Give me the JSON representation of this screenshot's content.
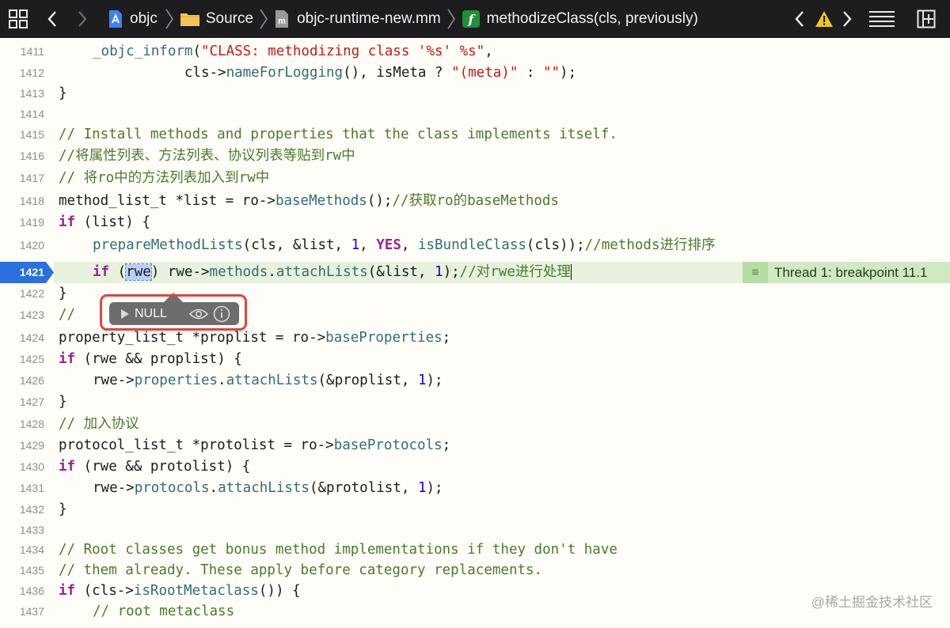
{
  "breadcrumb": {
    "project": "objc",
    "folder": "Source",
    "file": "objc-runtime-new.mm",
    "symbol": "methodizeClass(cls, previously)"
  },
  "toolbar": {
    "grid_icon": "grid-icon",
    "back_icon": "chevron-left-icon",
    "forward_icon": "chevron-right-icon",
    "issue_prev_icon": "chevron-left-icon",
    "warning_icon": "warning-icon",
    "issue_next_icon": "chevron-right-icon",
    "menu_icon": "lines-icon",
    "add_editor_icon": "add-editor-icon"
  },
  "lines": [
    {
      "num": "1411",
      "indent": 1,
      "tokens": [
        [
          "fn",
          "_objc_inform"
        ],
        [
          "id",
          "("
        ],
        [
          "str",
          "\"CLASS: methodizing class '%s' %s\""
        ],
        [
          "id",
          ","
        ]
      ]
    },
    {
      "num": "1412",
      "indent": 2,
      "tokens": [
        [
          "id",
          "           cls->"
        ],
        [
          "fn",
          "nameForLogging"
        ],
        [
          "id",
          "(), isMeta ? "
        ],
        [
          "str",
          "\"(meta)\""
        ],
        [
          "id",
          " : "
        ],
        [
          "str",
          "\"\""
        ],
        [
          "id",
          ");"
        ]
      ]
    },
    {
      "num": "1413",
      "indent": 0,
      "tokens": [
        [
          "id",
          "}"
        ]
      ]
    },
    {
      "num": "1414",
      "indent": 0,
      "tokens": []
    },
    {
      "num": "1415",
      "indent": 0,
      "tokens": [
        [
          "cm",
          "// Install methods and properties that the class implements itself."
        ]
      ]
    },
    {
      "num": "1416",
      "indent": 0,
      "tokens": [
        [
          "cm",
          "//将属性列表、方法列表、协议列表等贴到rw中"
        ]
      ]
    },
    {
      "num": "1417",
      "indent": 0,
      "tokens": [
        [
          "cm",
          "// 将ro中的方法列表加入到rw中"
        ]
      ]
    },
    {
      "num": "1418",
      "indent": 0,
      "tokens": [
        [
          "id",
          "method_list_t *list = ro->"
        ],
        [
          "fn",
          "baseMethods"
        ],
        [
          "id",
          "();"
        ],
        [
          "cm",
          "//获取ro的baseMethods"
        ]
      ]
    },
    {
      "num": "1419",
      "indent": 0,
      "tokens": [
        [
          "kw",
          "if"
        ],
        [
          "id",
          " (list) {"
        ]
      ]
    },
    {
      "num": "1420",
      "indent": 1,
      "tokens": [
        [
          "fn",
          "prepareMethodLists"
        ],
        [
          "id",
          "(cls, &list, "
        ],
        [
          "num",
          "1"
        ],
        [
          "id",
          ", "
        ],
        [
          "kw",
          "YES"
        ],
        [
          "id",
          ", "
        ],
        [
          "fn",
          "isBundleClass"
        ],
        [
          "id",
          "(cls));"
        ],
        [
          "cm",
          "//methods进行排序"
        ]
      ]
    },
    {
      "num": "1421",
      "indent": 1,
      "current": true,
      "tokens": [
        [
          "kw",
          "if"
        ],
        [
          "id",
          " ("
        ],
        [
          "hl",
          "rwe"
        ],
        [
          "id",
          ") rwe->"
        ],
        [
          "fn",
          "methods"
        ],
        [
          "id",
          "."
        ],
        [
          "fn",
          "attachLists"
        ],
        [
          "id",
          "(&list, "
        ],
        [
          "num",
          "1"
        ],
        [
          "id",
          ");"
        ],
        [
          "cm",
          "//对rwe进行处理"
        ]
      ]
    },
    {
      "num": "1422",
      "indent": 0,
      "tokens": [
        [
          "id",
          "}"
        ]
      ]
    },
    {
      "num": "1423",
      "indent": 0,
      "tokens": [
        [
          "cm",
          "//"
        ]
      ]
    },
    {
      "num": "1424",
      "indent": 0,
      "tokens": [
        [
          "id",
          "property_list_t *proplist = ro->"
        ],
        [
          "fn",
          "baseProperties"
        ],
        [
          "id",
          ";"
        ]
      ]
    },
    {
      "num": "1425",
      "indent": 0,
      "tokens": [
        [
          "kw",
          "if"
        ],
        [
          "id",
          " (rwe && proplist) {"
        ]
      ]
    },
    {
      "num": "1426",
      "indent": 1,
      "tokens": [
        [
          "id",
          "rwe->"
        ],
        [
          "fn",
          "properties"
        ],
        [
          "id",
          "."
        ],
        [
          "fn",
          "attachLists"
        ],
        [
          "id",
          "(&proplist, "
        ],
        [
          "num",
          "1"
        ],
        [
          "id",
          ");"
        ]
      ]
    },
    {
      "num": "1427",
      "indent": 0,
      "tokens": [
        [
          "id",
          "}"
        ]
      ]
    },
    {
      "num": "1428",
      "indent": 0,
      "tokens": [
        [
          "cm",
          "// 加入协议"
        ]
      ]
    },
    {
      "num": "1429",
      "indent": 0,
      "tokens": [
        [
          "id",
          "protocol_list_t *protolist = ro->"
        ],
        [
          "fn",
          "baseProtocols"
        ],
        [
          "id",
          ";"
        ]
      ]
    },
    {
      "num": "1430",
      "indent": 0,
      "tokens": [
        [
          "kw",
          "if"
        ],
        [
          "id",
          " (rwe && protolist) {"
        ]
      ]
    },
    {
      "num": "1431",
      "indent": 1,
      "tokens": [
        [
          "id",
          "rwe->"
        ],
        [
          "fn",
          "protocols"
        ],
        [
          "id",
          "."
        ],
        [
          "fn",
          "attachLists"
        ],
        [
          "id",
          "(&protolist, "
        ],
        [
          "num",
          "1"
        ],
        [
          "id",
          ");"
        ]
      ]
    },
    {
      "num": "1432",
      "indent": 0,
      "tokens": [
        [
          "id",
          "}"
        ]
      ]
    },
    {
      "num": "1433",
      "indent": 0,
      "tokens": []
    },
    {
      "num": "1434",
      "indent": 0,
      "tokens": [
        [
          "cm",
          "// Root classes get bonus method implementations if they don't have"
        ]
      ]
    },
    {
      "num": "1435",
      "indent": 0,
      "tokens": [
        [
          "cm",
          "// them already. These apply before category replacements."
        ]
      ]
    },
    {
      "num": "1436",
      "indent": 0,
      "tokens": [
        [
          "kw",
          "if"
        ],
        [
          "id",
          " (cls->"
        ],
        [
          "fn",
          "isRootMetaclass"
        ],
        [
          "id",
          "()) {"
        ]
      ]
    },
    {
      "num": "1437",
      "indent": 1,
      "tokens": [
        [
          "cm",
          "// root metaclass"
        ]
      ]
    }
  ],
  "breakpoint": {
    "label": "Thread 1: breakpoint 11.1"
  },
  "popup": {
    "value": "NULL"
  },
  "watermark": "@稀土掘金技术社区"
}
